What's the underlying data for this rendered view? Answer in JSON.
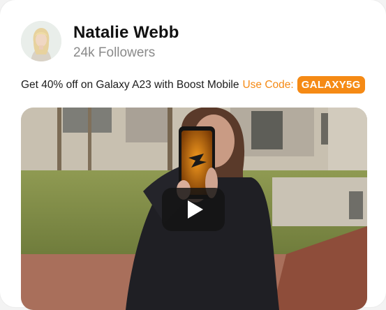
{
  "profile": {
    "name": "Natalie Webb",
    "followers": "24k Followers"
  },
  "promo": {
    "text": "Get 40% off on Galaxy A23 with Boost Mobile",
    "use_code_label": "Use Code:",
    "code": "GALAXY5G"
  },
  "video": {
    "play_icon": "play-icon",
    "phone_logo_icon": "boost-logo-icon"
  },
  "colors": {
    "accent": "#f58a15",
    "name_text": "#111111",
    "secondary_text": "#8a8a8a"
  }
}
